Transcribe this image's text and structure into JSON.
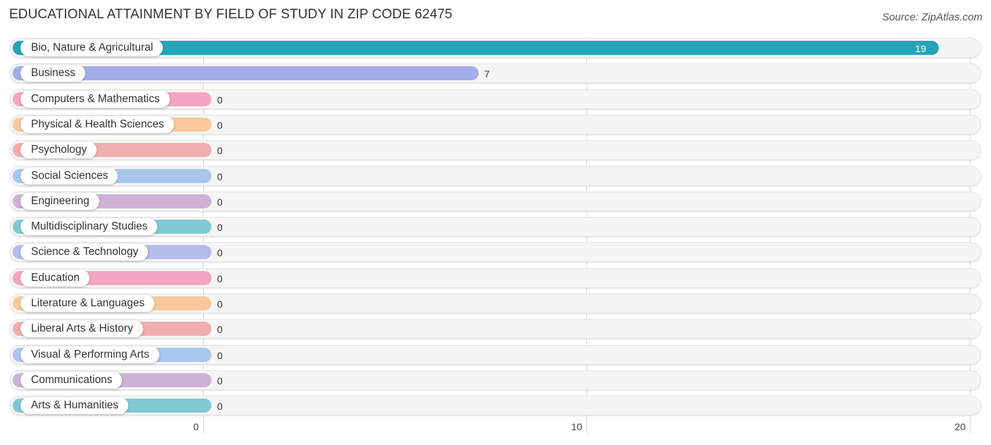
{
  "header": {
    "title": "EDUCATIONAL ATTAINMENT BY FIELD OF STUDY IN ZIP CODE 62475",
    "source": "Source: ZipAtlas.com"
  },
  "chart_data": {
    "type": "bar",
    "orientation": "horizontal",
    "title": "EDUCATIONAL ATTAINMENT BY FIELD OF STUDY IN ZIP CODE 62475",
    "xlabel": "",
    "ylabel": "",
    "xlim": [
      0,
      20
    ],
    "xticks": [
      0,
      10,
      20
    ],
    "grid": true,
    "categories": [
      "Bio, Nature & Agricultural",
      "Business",
      "Computers & Mathematics",
      "Physical & Health Sciences",
      "Psychology",
      "Social Sciences",
      "Engineering",
      "Multidisciplinary Studies",
      "Science & Technology",
      "Education",
      "Literature & Languages",
      "Liberal Arts & History",
      "Visual & Performing Arts",
      "Communications",
      "Arts & Humanities"
    ],
    "values": [
      19,
      7,
      0,
      0,
      0,
      0,
      0,
      0,
      0,
      0,
      0,
      0,
      0,
      0,
      0
    ],
    "colors": [
      "#26a5b8",
      "#a3ade8",
      "#f5a5c2",
      "#f9c99b",
      "#f0aeae",
      "#a9c6ec",
      "#d0b1d6",
      "#7fcad2",
      "#b5bdec",
      "#f5a5c2",
      "#f9c99b",
      "#f0aeae",
      "#a9c6ec",
      "#d0b1d6",
      "#7fcad2"
    ]
  }
}
